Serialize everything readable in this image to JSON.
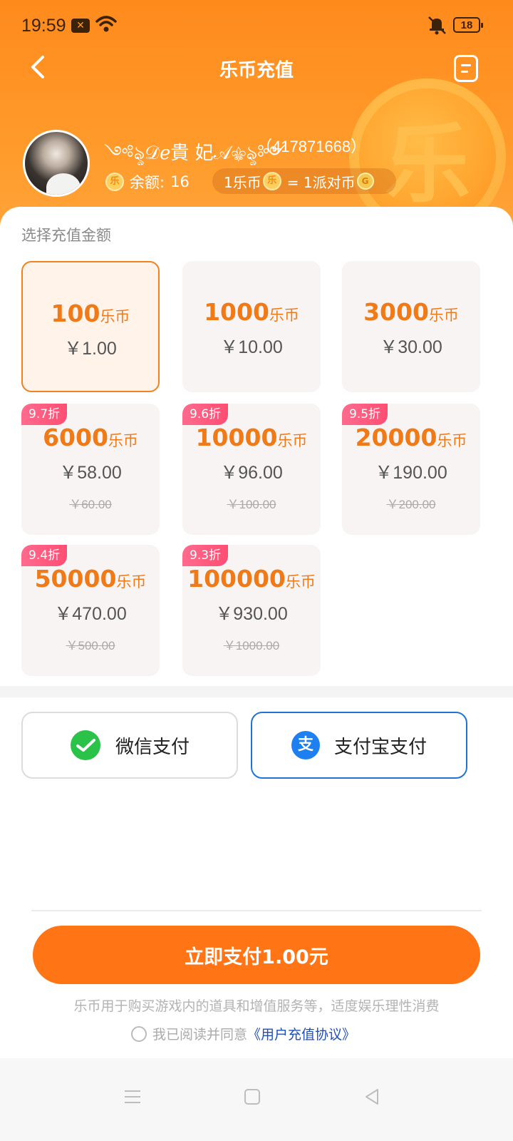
{
  "status": {
    "time": "19:59",
    "notification_icon": "x-badge-icon",
    "battery": "18"
  },
  "nav": {
    "title": "乐币充值",
    "back_icon": "back-arrow-icon",
    "menu_icon": "document-icon"
  },
  "header_coin_glyph": "乐",
  "user": {
    "name": "༺ৡ𝒟𝑒貴 妃𝒜⚜ৡ༻",
    "id": "（417871668）",
    "balance_label": "余额:",
    "balance_value": "16"
  },
  "rate": {
    "left": "1乐币",
    "coin_glyph": "乐",
    "right": "= 1派对币",
    "party_glyph": "G"
  },
  "section_label": "选择充值金额",
  "unit": "乐币",
  "packages": [
    {
      "amount": "100",
      "price": "￥1.00",
      "original": "",
      "badge": "",
      "selected": true
    },
    {
      "amount": "1000",
      "price": "￥10.00",
      "original": "",
      "badge": "",
      "selected": false
    },
    {
      "amount": "3000",
      "price": "￥30.00",
      "original": "",
      "badge": "",
      "selected": false
    },
    {
      "amount": "6000",
      "price": "￥58.00",
      "original": "￥60.00",
      "badge": "9.7折",
      "selected": false
    },
    {
      "amount": "10000",
      "price": "￥96.00",
      "original": "￥100.00",
      "badge": "9.6折",
      "selected": false
    },
    {
      "amount": "20000",
      "price": "￥190.00",
      "original": "￥200.00",
      "badge": "9.5折",
      "selected": false
    },
    {
      "amount": "50000",
      "price": "￥470.00",
      "original": "￥500.00",
      "badge": "9.4折",
      "selected": false
    },
    {
      "amount": "100000",
      "price": "￥930.00",
      "original": "￥1000.00",
      "badge": "9.3折",
      "selected": false
    }
  ],
  "payment": {
    "wechat_label": "微信支付",
    "alipay_label": "支付宝支付",
    "alipay_glyph": "支",
    "selected": "alipay"
  },
  "submit_label": "立即支付1.00元",
  "notice": "乐币用于购买游戏内的道具和增值服务等，适度娱乐理性消费",
  "agreement": {
    "prefix": "我已阅读并同意",
    "link": "《用户充值协议》"
  },
  "colors": {
    "accent": "#ff7414",
    "header": "#ff8a1c",
    "badge": "#ff5a7c",
    "alipay_border": "#1f73d6"
  }
}
